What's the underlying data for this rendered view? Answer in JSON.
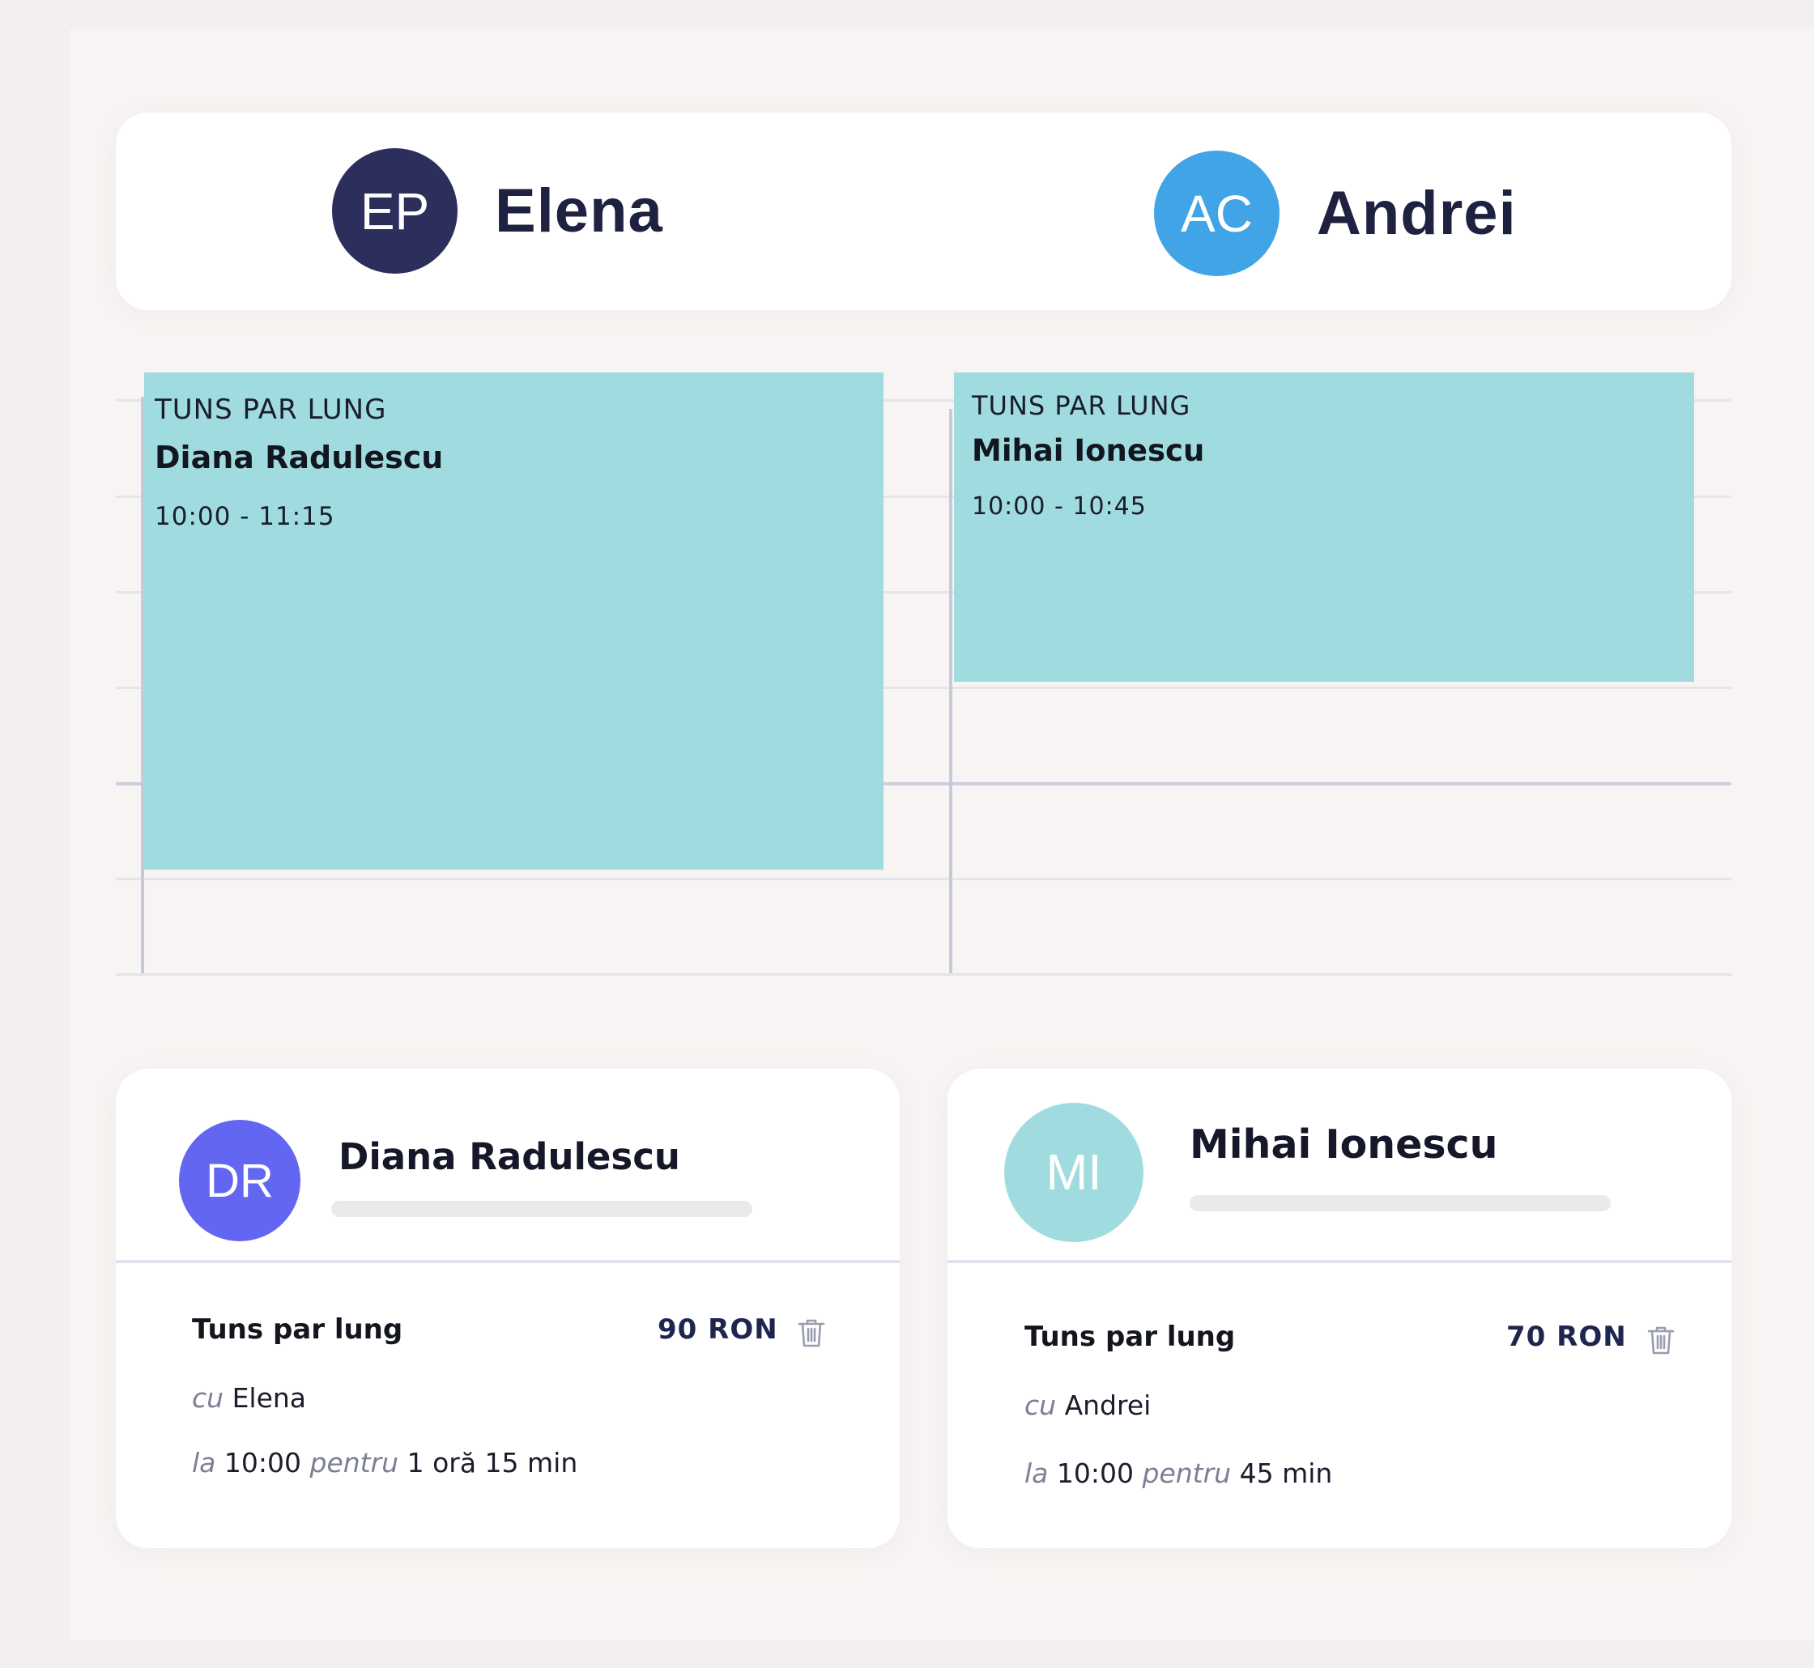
{
  "staff": [
    {
      "initials": "EP",
      "name": "Elena",
      "color": "#2c2f5b"
    },
    {
      "initials": "AC",
      "name": "Andrei",
      "color": "#40a4e6"
    }
  ],
  "appointments": [
    {
      "service": "TUNS PAR LUNG",
      "client": "Diana Radulescu",
      "time": "10:00 - 11:15",
      "color": "#a0dcdf"
    },
    {
      "service": "TUNS PAR LUNG",
      "client": "Mihai Ionescu",
      "time": "10:00 - 10:45",
      "color": "#a0dcdf"
    }
  ],
  "bookings": [
    {
      "initials": "DR",
      "avatar_color": "#6366f0",
      "client": "Diana Radulescu",
      "service": "Tuns par lung",
      "price": "90 RON",
      "with_label": "cu",
      "staff": "Elena",
      "at_label": "la",
      "time": "10:00",
      "for_label": "pentru",
      "duration": "1 oră 15 min"
    },
    {
      "initials": "MI",
      "avatar_color": "#a0dcdf",
      "client": "Mihai Ionescu",
      "service": "Tuns par lung",
      "price": "70 RON",
      "with_label": "cu",
      "staff": "Andrei",
      "at_label": "la",
      "time": "10:00",
      "for_label": "pentru",
      "duration": "45 min"
    }
  ],
  "icons": {
    "delete": "trash-icon"
  }
}
